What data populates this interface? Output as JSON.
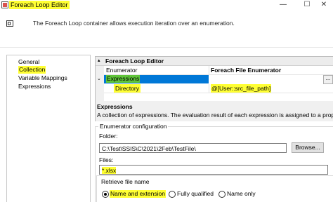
{
  "window": {
    "title": "Foreach Loop Editor",
    "controls": {
      "minimize": "—",
      "maximize": "☐",
      "close": "✕"
    }
  },
  "description": "The Foreach Loop container allows execution iteration over an enumeration.",
  "nav": {
    "items": [
      {
        "label": "General",
        "selected": false
      },
      {
        "label": "Collection",
        "selected": true
      },
      {
        "label": "Variable Mappings",
        "selected": false
      },
      {
        "label": "Expressions",
        "selected": false
      }
    ]
  },
  "grid": {
    "header": "Foreach Loop Editor",
    "rows": [
      {
        "name": "Enumerator",
        "value": "Foreach File Enumerator"
      },
      {
        "name": "Expressions",
        "value": "",
        "ellipsis": "..."
      },
      {
        "name": "Directory",
        "value": "@[User::src_file_path]"
      }
    ]
  },
  "property_description": {
    "title": "Expressions",
    "text": "A collection of expressions. The evaluation result of each expression is assigned to a proper..."
  },
  "enumerator_config": {
    "title": "Enumerator configuration",
    "folder_label": "Folder:",
    "folder_value": "C:\\Test\\SSIS\\C\\2021\\2Feb\\TestFile\\",
    "browse_label": "Browse...",
    "files_label": "Files:",
    "files_value": "*.xlsx",
    "retrieve_label": "Retrieve file name",
    "options": [
      {
        "label": "Name and extension",
        "checked": true
      },
      {
        "label": "Fully qualified",
        "checked": false
      },
      {
        "label": "Name only",
        "checked": false
      }
    ]
  },
  "colors": {
    "highlight": "#ffff33",
    "selection": "#0078d7"
  }
}
